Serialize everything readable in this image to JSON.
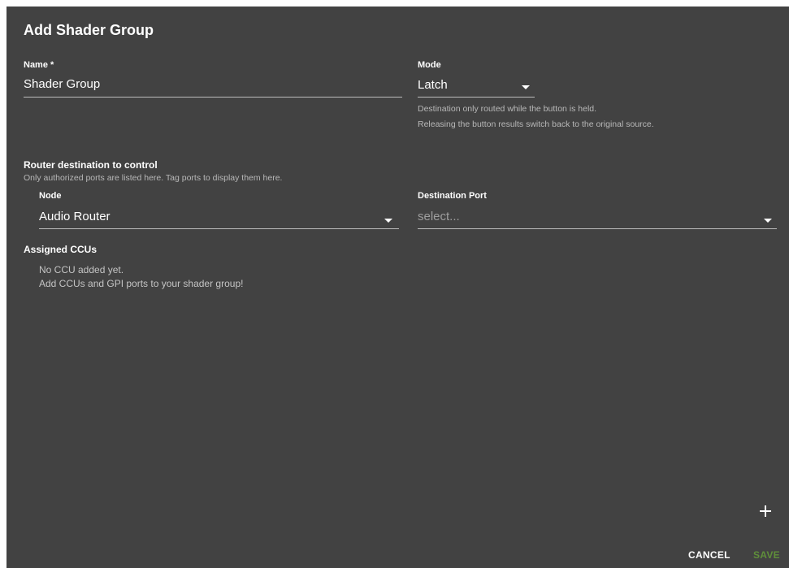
{
  "dialog": {
    "title": "Add Shader Group"
  },
  "name_field": {
    "label": "Name *",
    "value": "Shader Group"
  },
  "mode_field": {
    "label": "Mode",
    "value": "Latch",
    "hint_line1": "Destination only routed while the button is held.",
    "hint_line2": "Releasing the button results switch back to the original source."
  },
  "router": {
    "title": "Router destination to control",
    "subtitle": "Only authorized ports are listed here. Tag ports to display them here.",
    "node_label": "Node",
    "node_value": "Audio Router",
    "port_label": "Destination Port",
    "port_placeholder": "select..."
  },
  "ccus": {
    "title": "Assigned CCUs",
    "empty_line1": "No CCU added yet.",
    "empty_line2": "Add CCUs and GPI ports to your shader group!"
  },
  "actions": {
    "add_icon": "plus-icon",
    "cancel_label": "CANCEL",
    "save_label": "SAVE",
    "save_color": "#5f8f3a"
  },
  "colors": {
    "dialog_bg": "#424242",
    "text": "#ffffff",
    "hint": "#b8b8b8"
  }
}
